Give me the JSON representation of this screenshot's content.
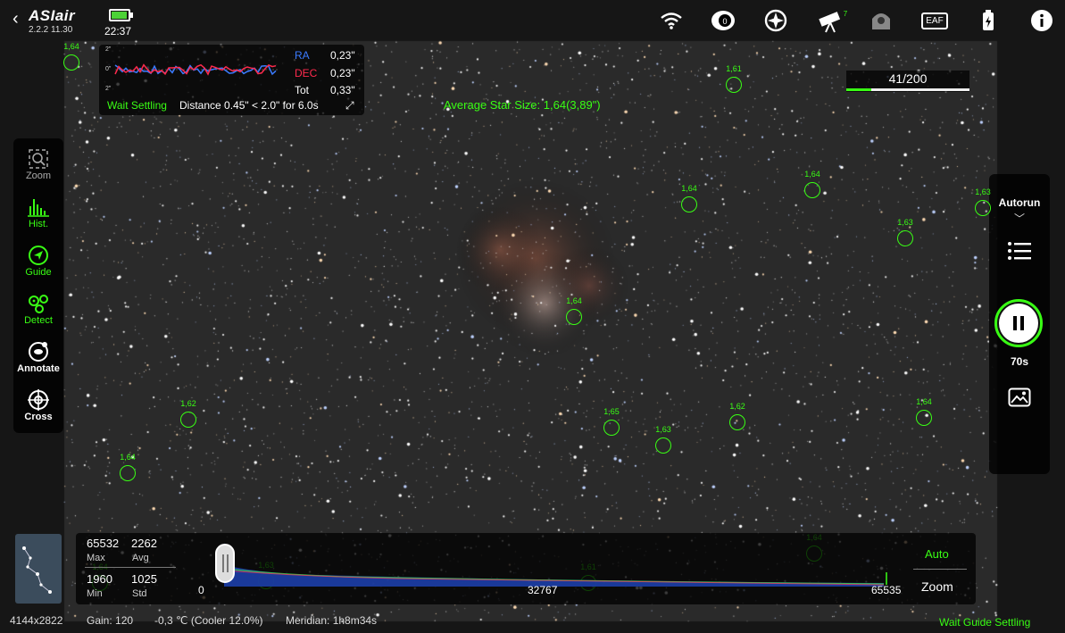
{
  "app": {
    "logo": "ASIair",
    "version": "2.2.2 11.30",
    "time": "22:37",
    "battery_level": 0.85
  },
  "topbar_icons": [
    "wifi-icon",
    "focuser-icon",
    "mount-icon",
    "telescope-icon",
    "camera-icon",
    "eaf-icon",
    "power-icon",
    "info-icon"
  ],
  "topbar": {
    "eaf_label": "EAF",
    "telescope_badge": "7"
  },
  "guide_panel": {
    "ra_label": "RA",
    "ra_value": "0,23\"",
    "dec_label": "DEC",
    "dec_value": "0,23\"",
    "tot_label": "Tot",
    "tot_value": "0,33\"",
    "scale_top": "2\"",
    "scale_mid": "0\"",
    "scale_bot": "2\"",
    "status": "Wait Settling",
    "distance": "Distance 0.45\" < 2.0\" for 6.0s",
    "ra_color": "#3b7bff",
    "dec_color": "#ff2a4d"
  },
  "average_star_size": "Average Star Size: 1,64(3,89\")",
  "progress": {
    "text": "41/200",
    "current": 41,
    "total": 200
  },
  "left_toolbar": [
    {
      "label": "Zoom",
      "icon": "zoom-icon",
      "active": false
    },
    {
      "label": "Hist.",
      "icon": "histogram-icon",
      "active": true
    },
    {
      "label": "Guide",
      "icon": "guide-icon",
      "active": true
    },
    {
      "label": "Detect",
      "icon": "detect-icon",
      "active": true
    },
    {
      "label": "Annotate",
      "icon": "annotate-icon",
      "active": false
    },
    {
      "label": "Cross",
      "icon": "crosshair-icon",
      "active": false
    }
  ],
  "right_panel": {
    "autorun": "Autorun",
    "exposure": "70s"
  },
  "stars": [
    {
      "label": "1,64"
    },
    {
      "label": "1,61"
    },
    {
      "label": "1,64"
    },
    {
      "label": "1,64"
    },
    {
      "label": "1,63"
    },
    {
      "label": "1,63"
    },
    {
      "label": "1,64"
    },
    {
      "label": "1,62"
    },
    {
      "label": "1,65"
    },
    {
      "label": "1,63"
    },
    {
      "label": "1,62"
    },
    {
      "label": "1,64"
    },
    {
      "label": "1,64"
    },
    {
      "label": "1,64"
    },
    {
      "label": "1,63"
    },
    {
      "label": "1,61"
    },
    {
      "label": "1,64"
    }
  ],
  "histogram": {
    "max": "65532",
    "max_label": "Max",
    "avg": "2262",
    "avg_label": "Avg",
    "min": "1960",
    "min_label": "Min",
    "std": "1025",
    "std_label": "Std",
    "axis_start": "0",
    "axis_mid": "32767",
    "axis_end": "65535",
    "auto_label": "Auto",
    "zoom_label": "Zoom"
  },
  "status_bar": {
    "resolution": "4144x2822",
    "gain": "Gain: 120",
    "temp": "-0,3 ℃ (Cooler 12.0%)",
    "meridian": "Meridian: 1h8m34s",
    "right": "Wait Guide Settling"
  }
}
